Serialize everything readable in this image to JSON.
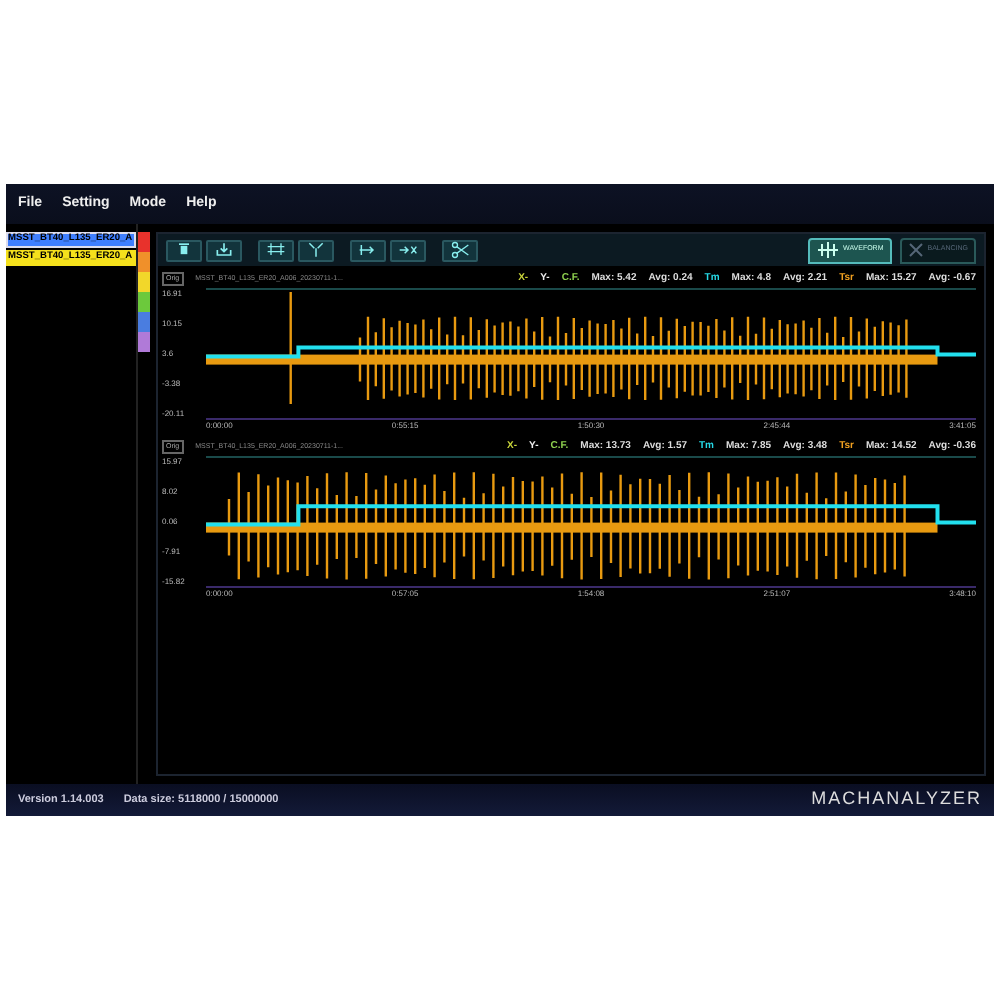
{
  "menu": [
    "File",
    "Setting",
    "Mode",
    "Help"
  ],
  "files": [
    {
      "name": "MSST_BT40_L135_ER20_A",
      "color": "#3f7fff",
      "selected": true
    },
    {
      "name": "MSST_BT40_L135_ER20_A",
      "color": "#f5e11c",
      "selected": false
    }
  ],
  "color_strip": [
    {
      "color": "#e8322c"
    },
    {
      "color": "#f0902a"
    },
    {
      "color": "#f2d72a"
    },
    {
      "color": "#6cc93c"
    },
    {
      "color": "#4a7de0"
    },
    {
      "color": "#b07ad8"
    }
  ],
  "toolbar": [
    {
      "kind": "trash"
    },
    {
      "kind": "export"
    },
    {
      "kind": "expand"
    },
    {
      "kind": "shrink"
    },
    {
      "kind": "pan"
    },
    {
      "kind": "remove"
    },
    {
      "kind": "cut"
    }
  ],
  "mode_tabs": [
    {
      "label": "WAVEFORM",
      "kind": "wave",
      "selected": true
    },
    {
      "label": "BALANCING",
      "kind": "cross",
      "selected": false
    }
  ],
  "charts": [
    {
      "tag": "Orig",
      "file": "MSST_BT40_L135_ER20_A006_20230711-1...",
      "axes": [
        "X-",
        "Y-"
      ],
      "stats": [
        {
          "channel": "C.F.",
          "color": "#8fd14f",
          "max": "Max: 5.42",
          "avg": "Avg: 0.24"
        },
        {
          "channel": "Tm",
          "color": "#25d9e6",
          "max": "Max: 4.8",
          "avg": "Avg: 2.21"
        },
        {
          "channel": "Tsr",
          "color": "#f0a020",
          "max": "Max: 15.27",
          "avg": "Avg: -0.67"
        }
      ],
      "yticks": [
        "16.91",
        "10.15",
        "3.6",
        "-3.38",
        "-20.11"
      ],
      "xticks": [
        "0:00:00",
        "0:55:15",
        "1:50:30",
        "2:45:44",
        "3:41:05"
      ]
    },
    {
      "tag": "Orig",
      "file": "MSST_BT40_L135_ER20_A006_20230711-1...",
      "axes": [
        "X-",
        "Y-"
      ],
      "stats": [
        {
          "channel": "C.F.",
          "color": "#8fd14f",
          "max": "Max: 13.73",
          "avg": "Avg: 1.57"
        },
        {
          "channel": "Tm",
          "color": "#25d9e6",
          "max": "Max: 7.85",
          "avg": "Avg: 3.48"
        },
        {
          "channel": "Tsr",
          "color": "#f0a020",
          "max": "Max: 14.52",
          "avg": "Avg: -0.36"
        }
      ],
      "yticks": [
        "15.97",
        "8.02",
        "0.06",
        "-7.91",
        "-15.82"
      ],
      "xticks": [
        "0:00:00",
        "0:57:05",
        "1:54:08",
        "2:51:07",
        "3:48:10"
      ]
    }
  ],
  "status": {
    "version": "Version 1.14.003",
    "data_size": "Data size: 5118000 / 15000000",
    "brand": "MACHANALYZER"
  }
}
